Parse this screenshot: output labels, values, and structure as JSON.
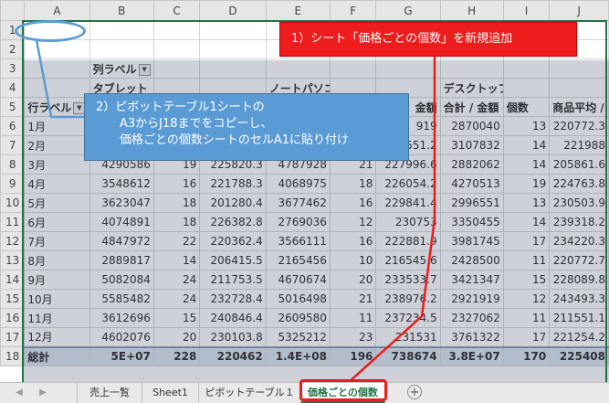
{
  "columns": [
    "A",
    "B",
    "C",
    "D",
    "E",
    "F",
    "G",
    "H",
    "I",
    "J"
  ],
  "row_numbers": [
    "1",
    "2",
    "3",
    "4",
    "5",
    "6",
    "7",
    "8",
    "9",
    "10",
    "11",
    "12",
    "13",
    "14",
    "15",
    "16",
    "17",
    "18"
  ],
  "pivot": {
    "column_label_header": "列ラベル",
    "row_label_header": "行ラベル",
    "groups": [
      "タブレット",
      "ノートパソコン",
      "デスクトップパソコン"
    ],
    "r5": {
      "g": "金額",
      "h": "合計 / 金額",
      "i": "個数",
      "j1": "商品",
      "j2": "平均 / 金額"
    },
    "rows": [
      {
        "label": "1月",
        "b": "",
        "c": "",
        "d": "",
        "e": "",
        "f": "",
        "g": "919",
        "h": "2870040",
        "i": "13",
        "j": "220772.3"
      },
      {
        "label": "2月",
        "b": "",
        "c": "",
        "d": "",
        "e": "",
        "f": "",
        "g": "551.2",
        "h": "3107832",
        "i": "14",
        "j": "221988"
      },
      {
        "label": "3月",
        "b": "4290586",
        "c": "19",
        "d": "225820.3",
        "e": "4787928",
        "f": "21",
        "g": "227996.6",
        "h": "2882062",
        "i": "14",
        "j": "205861.6"
      },
      {
        "label": "4月",
        "b": "3548612",
        "c": "16",
        "d": "221788.3",
        "e": "4068975",
        "f": "18",
        "g": "226054.2",
        "h": "4270513",
        "i": "19",
        "j": "224763.8"
      },
      {
        "label": "5月",
        "b": "3623047",
        "c": "18",
        "d": "201280.4",
        "e": "3677462",
        "f": "16",
        "g": "229841.4",
        "h": "2996551",
        "i": "13",
        "j": "230503.9"
      },
      {
        "label": "6月",
        "b": "4074891",
        "c": "18",
        "d": "226382.8",
        "e": "2769036",
        "f": "12",
        "g": "230753",
        "h": "3350455",
        "i": "14",
        "j": "239318.2"
      },
      {
        "label": "7月",
        "b": "4847972",
        "c": "22",
        "d": "220362.4",
        "e": "3566111",
        "f": "16",
        "g": "222881.9",
        "h": "3981745",
        "i": "17",
        "j": "234220.3"
      },
      {
        "label": "8月",
        "b": "2889817",
        "c": "14",
        "d": "206415.5",
        "e": "2165456",
        "f": "10",
        "g": "216545.6",
        "h": "2428500",
        "i": "11",
        "j": "220772.7"
      },
      {
        "label": "9月",
        "b": "5082084",
        "c": "24",
        "d": "211753.5",
        "e": "4670674",
        "f": "20",
        "g": "233533.7",
        "h": "3421347",
        "i": "15",
        "j": "228089.8"
      },
      {
        "label": "10月",
        "b": "5585482",
        "c": "24",
        "d": "232728.4",
        "e": "5016498",
        "f": "21",
        "g": "238976.2",
        "h": "2921919",
        "i": "12",
        "j": "243493.3"
      },
      {
        "label": "11月",
        "b": "3612696",
        "c": "15",
        "d": "240846.4",
        "e": "2609580",
        "f": "11",
        "g": "237234.5",
        "h": "2327062",
        "i": "11",
        "j": "211551.1"
      },
      {
        "label": "12月",
        "b": "4602076",
        "c": "20",
        "d": "230103.8",
        "e": "5325212",
        "f": "23",
        "g": "231531",
        "h": "3761322",
        "i": "17",
        "j": "221254.2"
      }
    ],
    "total": {
      "label": "総計",
      "b": "5E+07",
      "c": "228",
      "d": "220462",
      "e": "1.4E+08",
      "f": "196",
      "g": "738674",
      "h": "3.8E+07",
      "i": "170",
      "j": "225408"
    }
  },
  "annotations": {
    "step1": "1）シート「価格ごとの個数」を新規追加",
    "step2_line1": "2）ピボットテーブル1シートの",
    "step2_line2": "A3からJ18までをコピーし、",
    "step2_line3": "価格ごとの個数シートのセルA1に貼り付け"
  },
  "tabs": [
    "売上一覧",
    "Sheet1",
    "ピボットテーブル１",
    "価格ごとの個数"
  ],
  "active_tab": "価格ごとの個数",
  "nav": {
    "prev": "◀",
    "next": "▶",
    "add": "+"
  },
  "colors": {
    "accent_green": "#217346",
    "callout_red": "#ee1c1c",
    "callout_blue": "#5b9bd5"
  },
  "icons": [
    "filter-dropdown-icon",
    "add-sheet-icon",
    "scroll-left-icon",
    "scroll-right-icon"
  ]
}
